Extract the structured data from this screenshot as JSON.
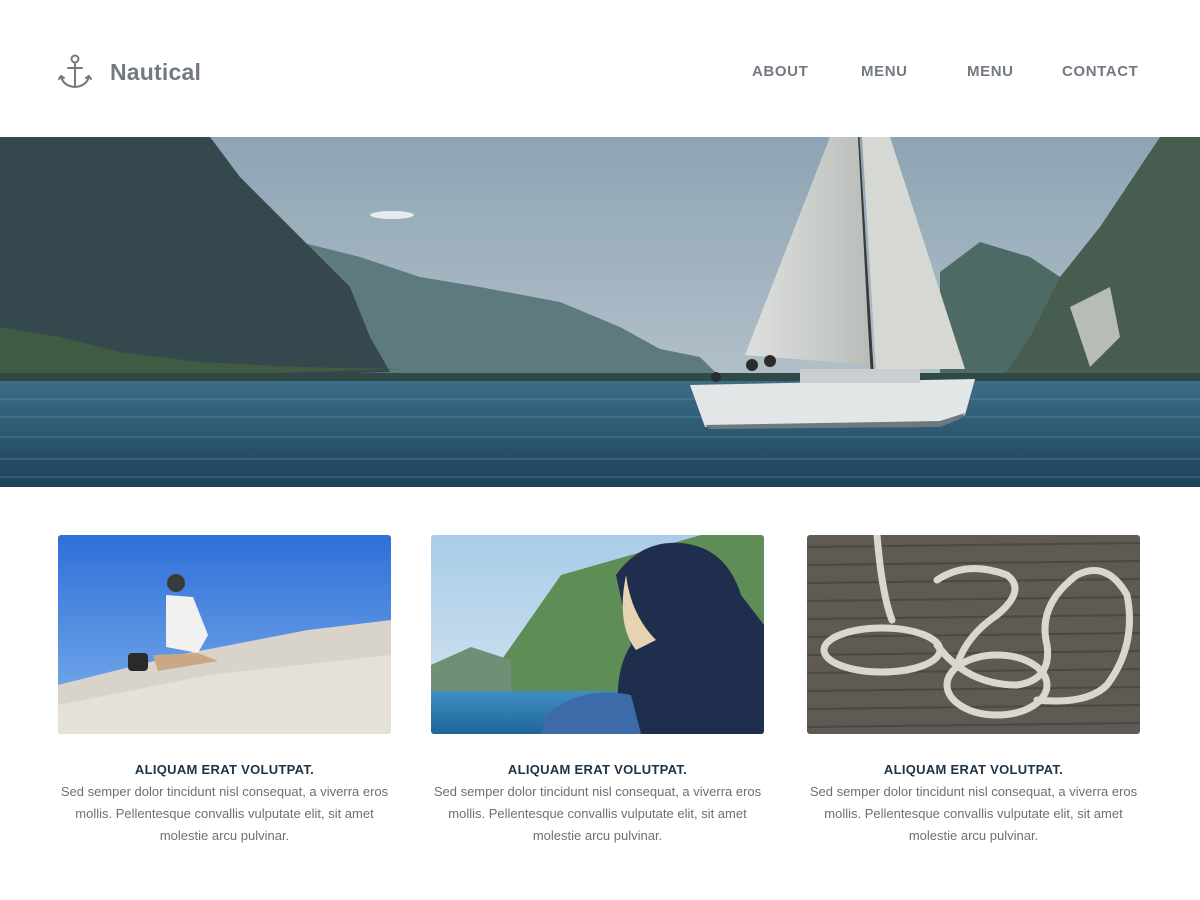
{
  "brand": {
    "name": "Nautical",
    "icon": "anchor-icon"
  },
  "nav": {
    "items": [
      {
        "label": "ABOUT"
      },
      {
        "label": "MENU"
      },
      {
        "label": "MENU"
      },
      {
        "label": "CONTACT"
      }
    ]
  },
  "hero": {
    "image": "sailboat-on-lake-photo"
  },
  "cards": [
    {
      "image": "woman-on-sand-dune-photo",
      "title": "ALIQUAM ERAT VOLUTPAT.",
      "text": "Sed semper dolor tincidunt nisl consequat, a viverra eros mollis. Pellentesque convallis vulputate elit, sit amet molestie arcu pulvinar."
    },
    {
      "image": "person-in-hood-by-lake-photo",
      "title": "ALIQUAM ERAT VOLUTPAT.",
      "text": "Sed semper dolor tincidunt nisl consequat, a viverra eros mollis. Pellentesque convallis vulputate elit, sit amet molestie arcu pulvinar."
    },
    {
      "image": "rope-on-dock-photo",
      "title": "ALIQUAM ERAT VOLUTPAT.",
      "text": "Sed semper dolor tincidunt nisl consequat, a viverra eros mollis. Pellentesque convallis vulputate elit, sit amet molestie arcu pulvinar."
    }
  ],
  "colors": {
    "nav_text": "#727980",
    "card_title": "#1d3348",
    "body_text": "#6f6f6f"
  }
}
